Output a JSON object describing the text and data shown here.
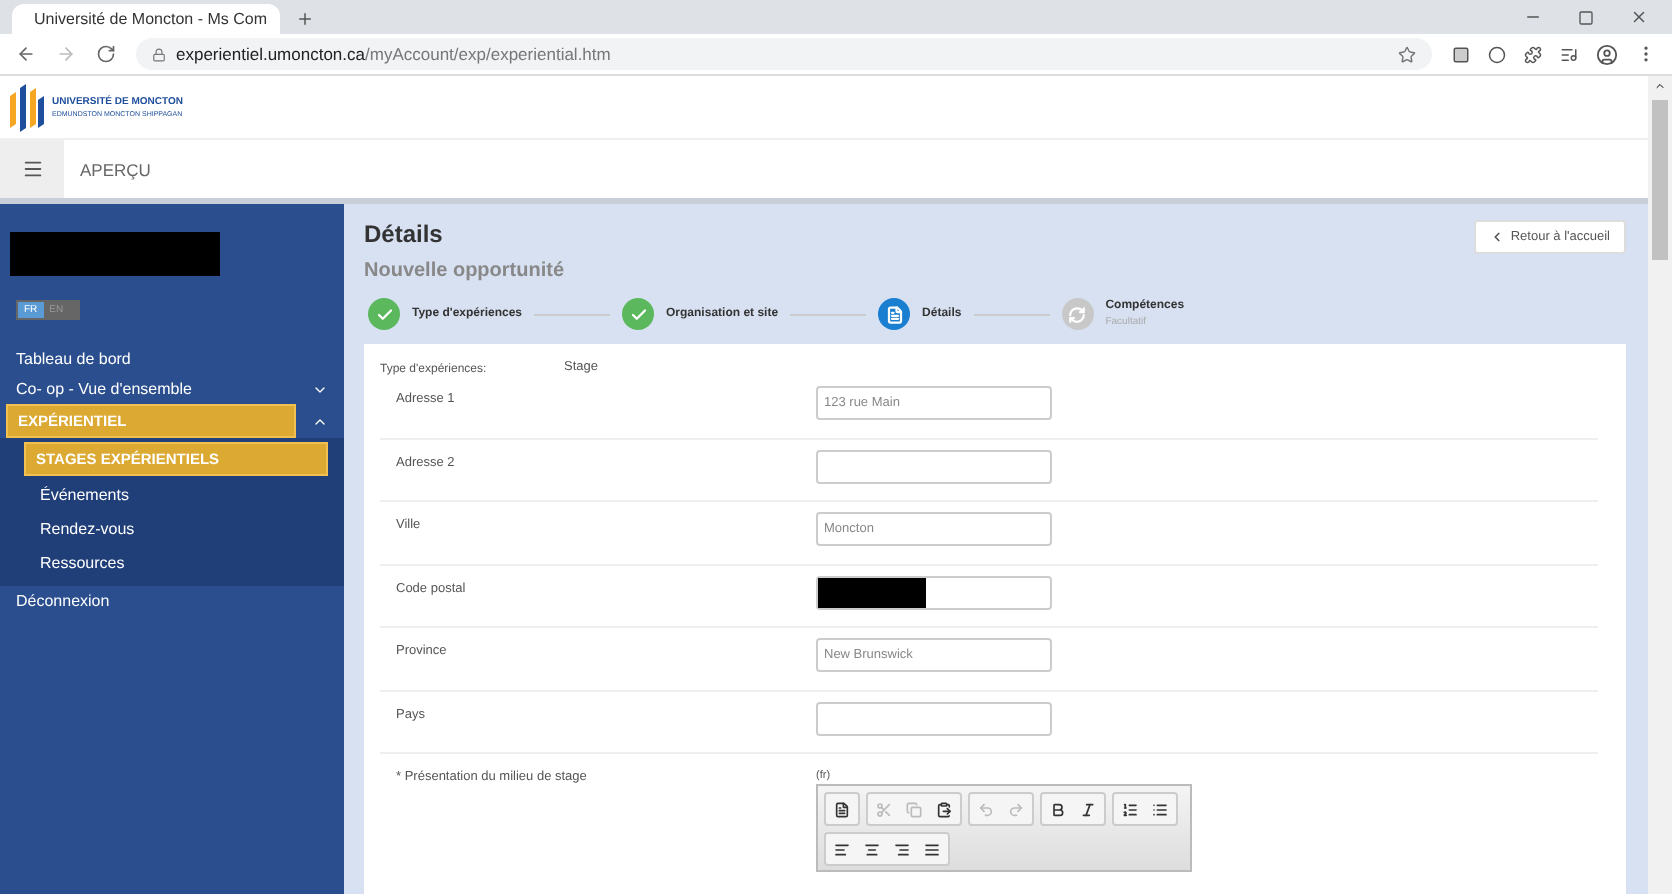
{
  "browser": {
    "tab_title": "Université de Moncton - Ms Com",
    "url_host": "experientiel.umoncton.ca",
    "url_path": "/myAccount/exp/experiential.htm"
  },
  "header": {
    "logo_title": "UNIVERSITÉ DE MONCTON",
    "logo_subtitle": "EDMUNDSTON MONCTON SHIPPAGAN",
    "page_label": "APERÇU"
  },
  "sidebar": {
    "profile": {
      "redacted": true
    },
    "languages": [
      {
        "label": "FR",
        "selected": true
      },
      {
        "label": "EN",
        "selected": false
      }
    ],
    "items": [
      {
        "label": "Tableau de bord",
        "selected": false
      },
      {
        "label": "Co- op - Vue d'ensemble",
        "selected": false,
        "expanded": false
      },
      {
        "label": "EXPÉRIENTIEL",
        "selected": true,
        "expanded": true,
        "children": [
          {
            "label": "STAGES EXPÉRIENTIELS",
            "selected": true
          },
          {
            "label": "Événements",
            "selected": false
          },
          {
            "label": "Rendez-vous",
            "selected": false
          },
          {
            "label": "Ressources",
            "selected": false
          }
        ]
      },
      {
        "label": "Déconnexion",
        "selected": false
      }
    ]
  },
  "main": {
    "title": "Détails",
    "subtitle": "Nouvelle opportunité",
    "back_button": "Retour à l'accueil",
    "steps": [
      {
        "label": "Type d'expériences",
        "kind": "done"
      },
      {
        "label": "Organisation et site",
        "kind": "done"
      },
      {
        "label": "Détails",
        "kind": "current"
      },
      {
        "label": "Compétences",
        "note": "Facultatif",
        "kind": "pending"
      }
    ],
    "type_label": "Type d'expériences:",
    "type_value": "Stage",
    "fields": [
      {
        "label": "Adresse 1",
        "placeholder": "123 rue Main"
      },
      {
        "label": "Adresse 2"
      },
      {
        "label": "Ville",
        "placeholder": "Moncton"
      },
      {
        "label": "Code postal",
        "redacted": true
      },
      {
        "label": "Province",
        "placeholder": "New Brunswick"
      },
      {
        "label": "Pays"
      }
    ],
    "editor": {
      "label": "* Présentation du milieu de stage",
      "lang": "(fr)",
      "toolbar": [
        [
          {
            "kind": "source",
            "disabled": false
          }
        ],
        [
          {
            "kind": "cut",
            "disabled": true
          },
          {
            "kind": "copy",
            "disabled": true
          },
          {
            "kind": "paste",
            "disabled": false
          }
        ],
        [
          {
            "kind": "undo",
            "disabled": true
          },
          {
            "kind": "redo",
            "disabled": true
          }
        ],
        [
          {
            "kind": "bold",
            "disabled": false
          },
          {
            "kind": "italic",
            "disabled": false
          }
        ],
        [
          {
            "kind": "ordered-list",
            "disabled": false
          },
          {
            "kind": "bullet-list",
            "disabled": false
          }
        ],
        [
          {
            "kind": "align-left",
            "disabled": false
          },
          {
            "kind": "align-center",
            "disabled": false
          },
          {
            "kind": "align-right",
            "disabled": false
          },
          {
            "kind": "align-justify",
            "disabled": false
          }
        ]
      ]
    }
  }
}
